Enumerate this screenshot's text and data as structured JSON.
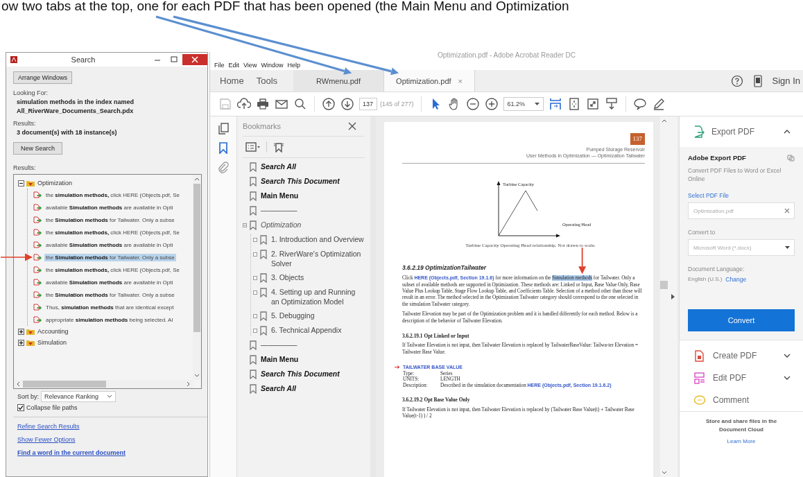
{
  "caption": "ow two tabs at the top, one for each PDF that has been opened (the Main Menu and Optimization",
  "search_window": {
    "title": "Search",
    "arrange_button": "Arrange Windows",
    "looking_for_label": "Looking For:",
    "query_lines": [
      "simulation methods in the index named",
      "All_RiverWare_Documents_Search.pdx"
    ],
    "results_label": "Results:",
    "results_summary": "3 document(s) with 18 instance(s)",
    "new_search_button": "New Search",
    "results_list_label": "Results:",
    "results_tree": [
      {
        "label": "Optimization",
        "expanded": true,
        "children": [
          {
            "text": "the **simulation methods,** click HERE (Objects.pdf, Se",
            "selected": false
          },
          {
            "text": "available **Simulation methods** are available in Opti",
            "selected": false
          },
          {
            "text": "the **Simulation methods** for Tailwater. Only a subse",
            "selected": false
          },
          {
            "text": "the **simulation methods,** click HERE (Objects.pdf, Se",
            "selected": false
          },
          {
            "text": "available **Simulation methods** are available in Opti",
            "selected": false
          },
          {
            "text": "the **Simulation methods** for Tailwater. Only a subse",
            "selected": true
          },
          {
            "text": "the **simulation methods,** click HERE (Objects.pdf, Se",
            "selected": false
          },
          {
            "text": "available **Simulation methods** are available in Opti",
            "selected": false
          },
          {
            "text": "the **Simulation methods** for Tailwater. Only a subse",
            "selected": false
          },
          {
            "text": "Thus, **simulation methods** that are identical except",
            "selected": false
          },
          {
            "text": "appropriate **simulation methods** being selected. Al",
            "selected": false
          }
        ]
      },
      {
        "label": "Accounting",
        "expanded": false
      },
      {
        "label": "Simulation",
        "expanded": false
      }
    ],
    "sort_by_label": "Sort by:",
    "sort_by_value": "Relevance Ranking",
    "collapse_file_paths": {
      "label": "Collapse file paths",
      "checked": true
    },
    "links": [
      {
        "text": "Refine Search Results",
        "bold": false
      },
      {
        "text": "Show Fewer Options",
        "bold": false
      },
      {
        "text": "Find a word in the current document",
        "bold": true
      }
    ]
  },
  "acrobat": {
    "title": "Optimization.pdf - Adobe Acrobat Reader DC",
    "menu": [
      "File",
      "Edit",
      "View",
      "Window",
      "Help"
    ],
    "nav_tabs": [
      "Home",
      "Tools"
    ],
    "doc_tabs": [
      {
        "label": "RWmenu.pdf",
        "selected": false
      },
      {
        "label": "Optimization.pdf",
        "selected": true,
        "close": "×"
      }
    ],
    "sign_in": "Sign In",
    "page_number": "137",
    "page_count": "(145 of 277)",
    "zoom": "61.2%",
    "bookmarks": {
      "title": "Bookmarks",
      "items": [
        {
          "label": "Search All",
          "kind": "bold_italic"
        },
        {
          "label": "Search This Document",
          "kind": "bold_italic"
        },
        {
          "label": "Main Menu",
          "kind": "bold"
        },
        {
          "label": "—————",
          "kind": "normal"
        },
        {
          "label": "Optimization",
          "kind": "italic",
          "expanded": true,
          "children": [
            {
              "label": "1. Introduction and Overview",
              "kind": "normal",
              "expanded": false
            },
            {
              "label": "2. RiverWare's Optimization Solver",
              "kind": "normal",
              "expanded": false
            },
            {
              "label": "3. Objects",
              "kind": "normal",
              "expanded": false
            },
            {
              "label": "4. Setting up and Running an Optimization Model",
              "kind": "normal",
              "expanded": false
            },
            {
              "label": "5. Debugging",
              "kind": "normal",
              "expanded": false
            },
            {
              "label": "6. Technical Appendix",
              "kind": "normal",
              "expanded": false
            }
          ]
        },
        {
          "label": "—————",
          "kind": "normal"
        },
        {
          "label": "Main Menu",
          "kind": "bold"
        },
        {
          "label": "Search This Document",
          "kind": "bold_italic"
        },
        {
          "label": "Search All",
          "kind": "bold_italic"
        }
      ]
    },
    "page": {
      "badge": "137",
      "header_lines": [
        "Pumped Storage Reservoir",
        "User Methods in Optimization — Optimization Tailwater"
      ],
      "figure": {
        "y_label": "Turbine Capacity",
        "x_label": "Operating Head",
        "caption": "Turbine Capacity Operating Head relationship. Not drawn to scale."
      },
      "blocks": [
        {
          "kind": "heading_italic",
          "text": "3.6.2.19 OptimizationTailwater"
        },
        {
          "kind": "paragraph",
          "parts": [
            {
              "kind": "plain",
              "text": "Click "
            },
            {
              "kind": "link",
              "text": "HERE (Objects.pdf, Section 19.1.6)"
            },
            {
              "kind": "plain",
              "text": " for more information on the "
            },
            {
              "kind": "highlight",
              "text": "Simulation methods"
            },
            {
              "kind": "plain",
              "text": " for Tailwater. Only a subset of available methods are supported in Optimization. These methods are: Linked or Input, Base Value Only, Base Value Plus Lookup Table, Stage Flow Lookup Table, and Coefficients Table. Selection of a method other than those will result in an error. The method selected in the Optimization Tailwater category should correspond to the one selected in the simulation Tailwater category."
            }
          ]
        },
        {
          "kind": "paragraph",
          "parts": [
            {
              "kind": "plain",
              "text": "Tailwater Elevation may be part of the Optimization problem and it is handled differently for each method. Below is a description of the behavior of Tailwater Elevation."
            }
          ]
        },
        {
          "kind": "heading",
          "text": "3.6.2.19.1 Opt Linked or Input"
        },
        {
          "kind": "paragraph",
          "parts": [
            {
              "kind": "plain",
              "text": "If Tailwater Elevation is not input, then Tailwater Elevation is replaced by TailwaterBaseValue: Tailwa-ter Elevation = Tailwater Base Value."
            }
          ]
        },
        {
          "kind": "slot",
          "title": "TAILWATER BASE VALUE",
          "rows": [
            {
              "label": "Type:",
              "parts": [
                {
                  "kind": "plain",
                  "text": "Series"
                }
              ]
            },
            {
              "label": "UNITS:",
              "parts": [
                {
                  "kind": "plain",
                  "text": "LENGTH"
                }
              ]
            },
            {
              "label": "Description:",
              "parts": [
                {
                  "kind": "plain",
                  "text": "Described in the simulation documentation "
                },
                {
                  "kind": "link",
                  "text": "HERE (Objects.pdf, Section 19.1.6.2)"
                }
              ]
            }
          ]
        },
        {
          "kind": "heading",
          "text": "3.6.2.19.2 Opt Base Value Only"
        },
        {
          "kind": "paragraph",
          "parts": [
            {
              "kind": "plain",
              "text": "If Tailwater Elevation is not input, then Tailwater Elevation is replaced by (Tailwater Base Value(t) + Tailwater Base Value(t-1) ) / 2"
            }
          ]
        }
      ]
    },
    "export_panel": {
      "header": "Export PDF",
      "expanded": true,
      "title": "Adobe Export PDF",
      "description": "Convert PDF Files to Word or Excel Online",
      "select_label": "Select PDF File",
      "file_value": "Optimization.pdf",
      "convert_to_label": "Convert to",
      "format": "Microsoft Word (*.docx)",
      "language_label": "Document Language:",
      "language": "English (U.S.)",
      "change_link": "Change",
      "convert_button": "Convert"
    },
    "tools": [
      {
        "label": "Create PDF",
        "kind": "create",
        "expandable": true
      },
      {
        "label": "Edit PDF",
        "kind": "edit",
        "expandable": true
      },
      {
        "label": "Comment",
        "kind": "comment",
        "expandable": false
      }
    ],
    "cloud": {
      "text": "Store and share files in the Document Cloud",
      "link": "Learn More"
    }
  }
}
